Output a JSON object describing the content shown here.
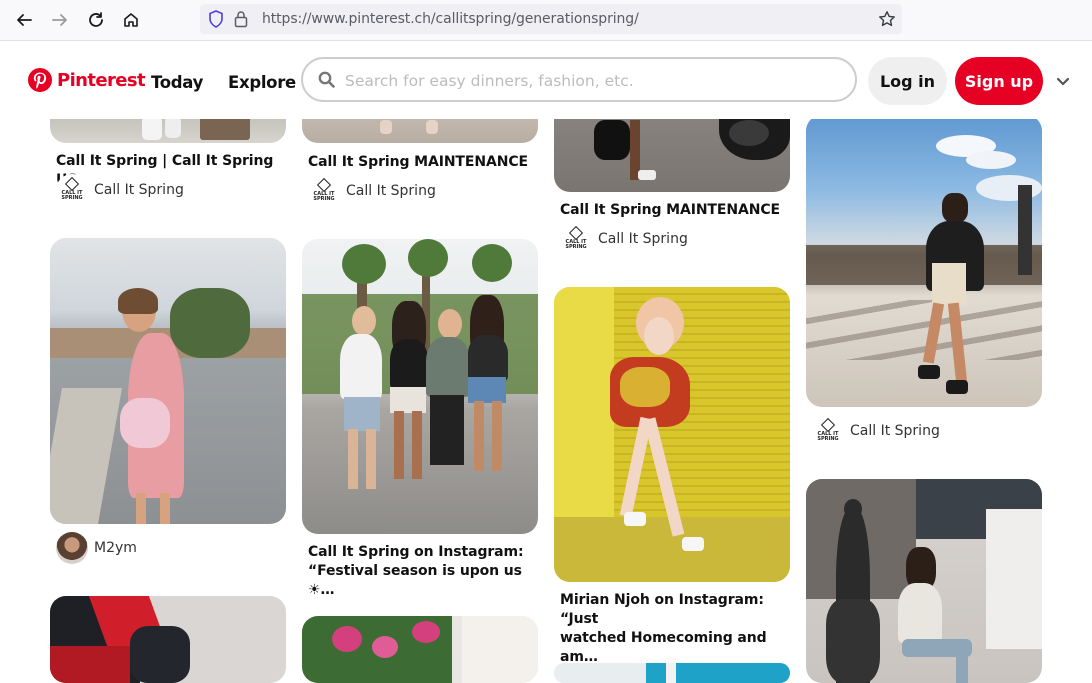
{
  "browser": {
    "url": "https://www.pinterest.ch/callitspring/generationspring/"
  },
  "header": {
    "logo_text": "Pinterest",
    "nav": [
      "Today",
      "Explore"
    ],
    "search_placeholder": "Search for easy dinners, fashion, etc.",
    "login_label": "Log in",
    "signup_label": "Sign up"
  },
  "colors": {
    "brand": "#e60023",
    "login_bg": "#efefef"
  },
  "pins": [
    {
      "title": "Call It Spring | Call It Spring US",
      "author": "Call It Spring"
    },
    {
      "title": "Call It Spring MAINTENANCE",
      "author": "Call It Spring"
    },
    {
      "title": "Call It Spring MAINTENANCE",
      "author": "Call It Spring"
    },
    {
      "author": "Call It Spring"
    },
    {
      "author": "M2ym"
    },
    {
      "title_line1": "Call It Spring on Instagram:",
      "title_line2": "“Festival season is upon us ☀…"
    },
    {
      "title_line1": "Mirian Njoh on Instagram: “Just",
      "title_line2": "watched Homecoming and am…"
    }
  ],
  "avatar_text": {
    "line1": "CALL IT",
    "line2": "SPRING"
  }
}
